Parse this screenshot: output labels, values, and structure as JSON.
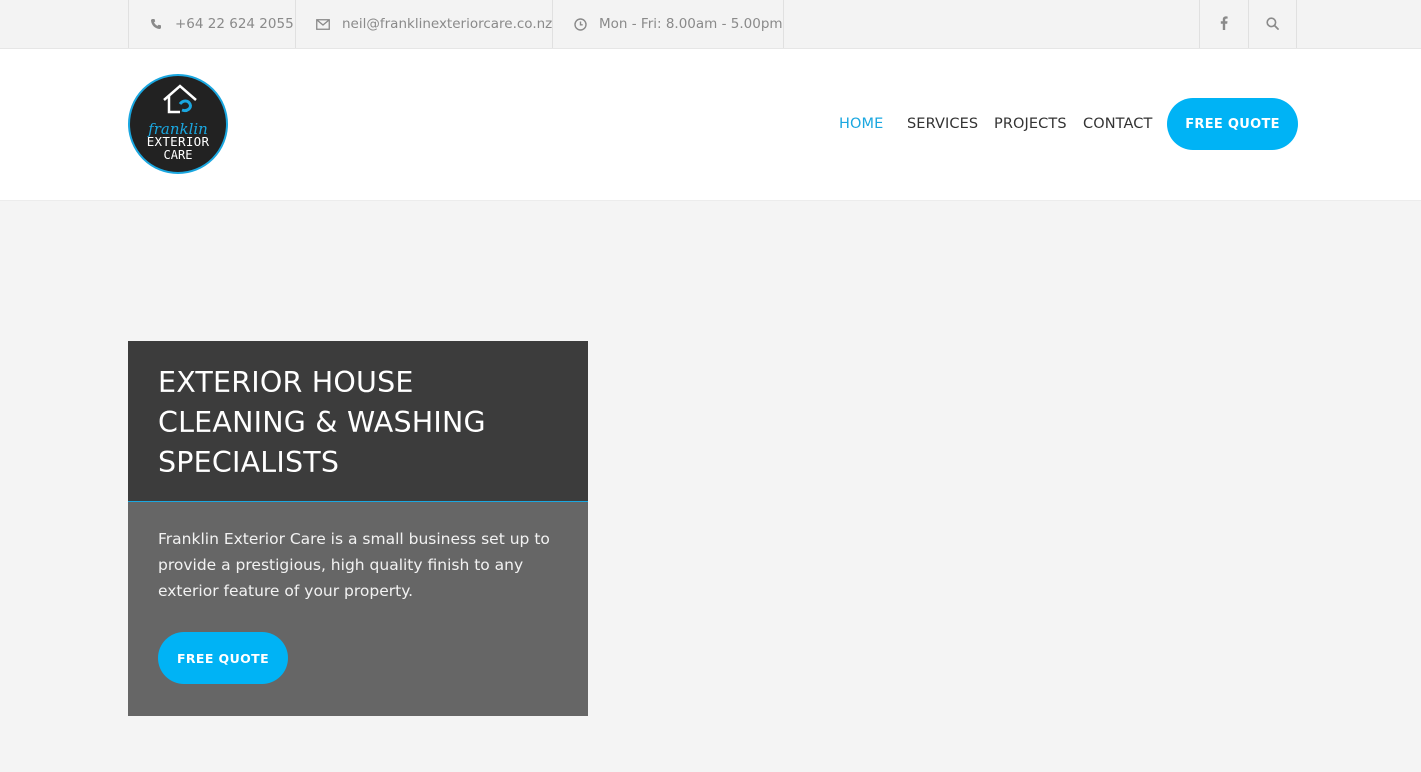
{
  "topbar": {
    "phone": "+64 22 624 2055",
    "email": "neil@franklinexteriorcare.co.nz",
    "hours": "Mon - Fri: 8.00am - 5.00pm",
    "icons": {
      "phone": "phone-icon",
      "email": "envelope-icon",
      "hours": "clock-icon",
      "facebook": "facebook-icon",
      "search": "search-icon"
    }
  },
  "logo": {
    "script": "franklin",
    "line1": "EXTERIOR",
    "line2": "CARE"
  },
  "nav": {
    "items": [
      {
        "label": "HOME",
        "active": true
      },
      {
        "label": "SERVICES"
      },
      {
        "label": "PROJECTS"
      },
      {
        "label": "CONTACT"
      }
    ],
    "cta": "FREE QUOTE"
  },
  "hero": {
    "title": "EXTERIOR HOUSE CLEANING & WASHING SPECIALISTS",
    "description": "Franklin Exterior Care is a small business set up to provide a prestigious, high quality finish to any exterior feature of your property.",
    "cta": "FREE QUOTE"
  },
  "colors": {
    "accent": "#00b3f5",
    "active_nav": "#1aa7e0",
    "hero_dark": "#3c3c3c",
    "hero_mid": "#666666"
  }
}
